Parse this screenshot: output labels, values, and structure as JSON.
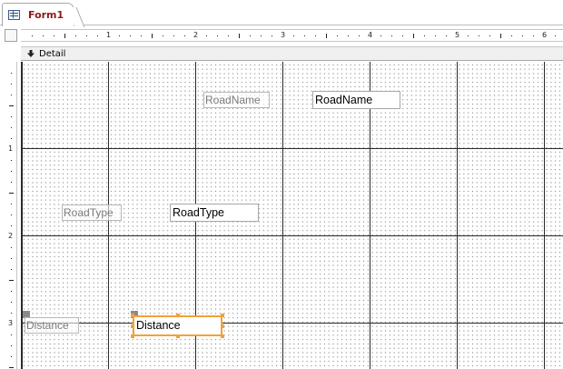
{
  "tab": {
    "label": "Form1",
    "icon": "form-icon"
  },
  "ruler": {
    "horizontal_labels": [
      "1",
      "2",
      "3",
      "4",
      "5",
      "6"
    ],
    "vertical_labels": [
      "1",
      "2",
      "3"
    ]
  },
  "section": {
    "label": "Detail",
    "icon": "section-down-arrow-icon"
  },
  "controls": {
    "roadname_label": "RoadName",
    "roadname_text": "RoadName",
    "roadtype_label": "RoadType",
    "roadtype_text": "RoadType",
    "distance_label": "Distance",
    "distance_text": "Distance"
  },
  "colors": {
    "tab_text": "#8b1a1a",
    "selection": "#f2a13a"
  }
}
